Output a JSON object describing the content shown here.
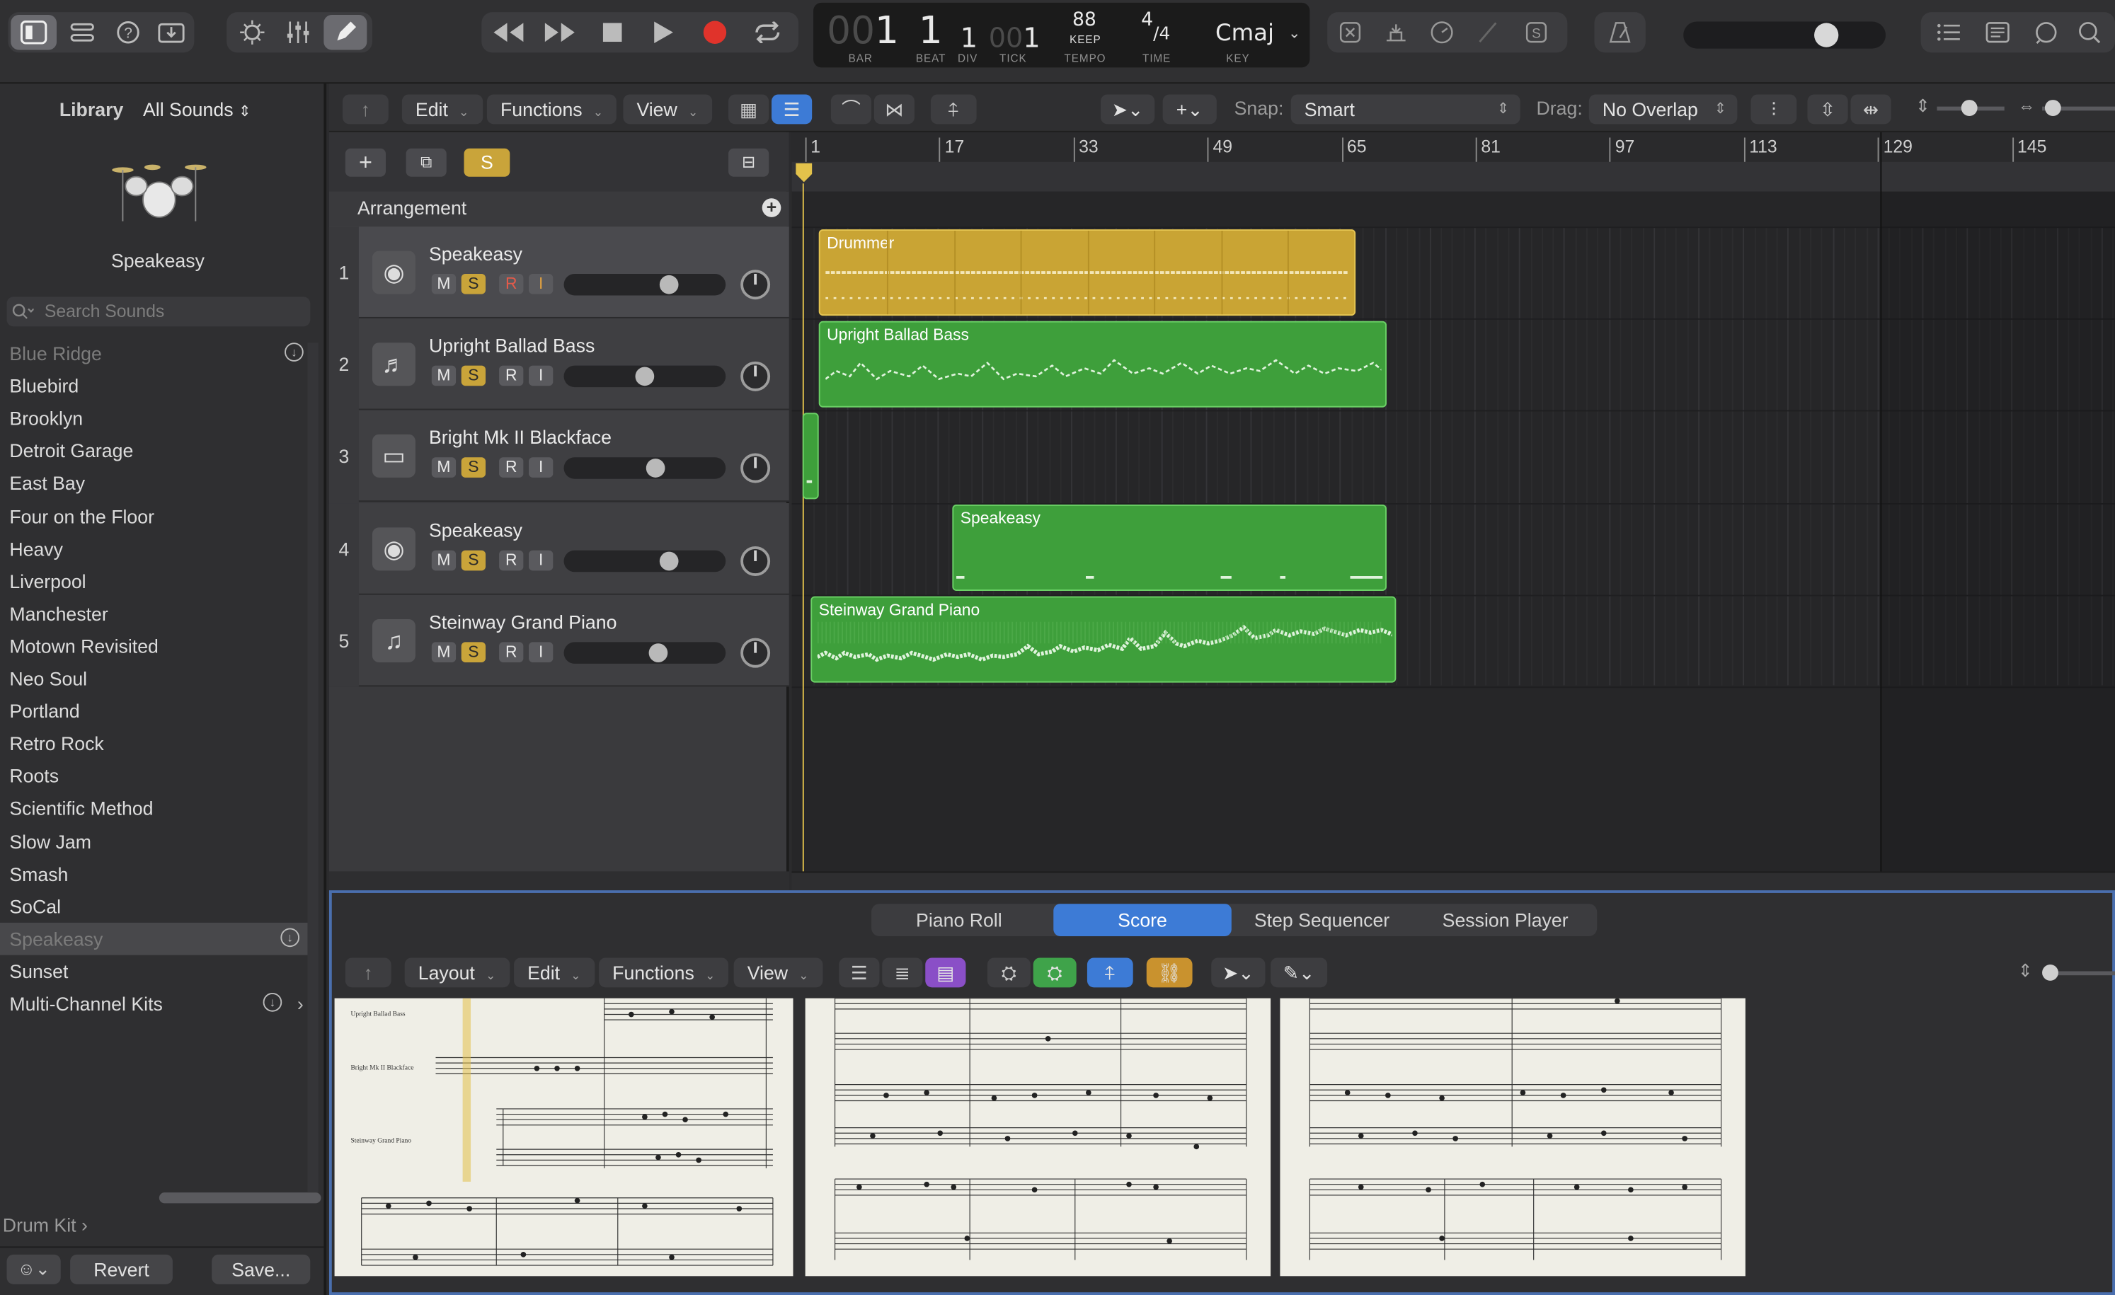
{
  "transport": {
    "bar_dim": "00",
    "bar": "1",
    "beat": "1",
    "div": "1",
    "tick_dim": "00",
    "tick": "1",
    "tempo": "88",
    "tempo_mode": "KEEP",
    "sig_num": "4",
    "sig_den": "/4",
    "key": "Cmaj",
    "labels": {
      "bar": "BAR",
      "beat": "BEAT",
      "div": "DIV",
      "tick": "TICK",
      "tempo": "TEMPO",
      "time": "TIME",
      "key": "KEY"
    }
  },
  "library": {
    "title": "Library",
    "filter": "All Sounds",
    "patch_name": "Speakeasy",
    "search_placeholder": "Search Sounds",
    "items": [
      "Blue Ridge",
      "Bluebird",
      "Brooklyn",
      "Detroit Garage",
      "East Bay",
      "Four on the Floor",
      "Heavy",
      "Liverpool",
      "Manchester",
      "Motown Revisited",
      "Neo Soul",
      "Portland",
      "Retro Rock",
      "Roots",
      "Scientific Method",
      "Slow Jam",
      "Smash",
      "SoCal",
      "Speakeasy",
      "Sunset",
      "Multi-Channel Kits"
    ],
    "footer_category": "Drum Kit",
    "revert": "Revert",
    "save": "Save..."
  },
  "tracks_header": {
    "edit": "Edit",
    "functions": "Functions",
    "view": "View",
    "snap_label": "Snap:",
    "snap_value": "Smart",
    "drag_label": "Drag:",
    "drag_value": "No Overlap"
  },
  "arrangement": {
    "label": "Arrangement",
    "solo": "S",
    "ruler": [
      "1",
      "17",
      "33",
      "49",
      "65",
      "81",
      "97",
      "113",
      "129",
      "145"
    ]
  },
  "tracks": [
    {
      "num": "1",
      "name": "Speakeasy",
      "volume": 0.67
    },
    {
      "num": "2",
      "name": "Upright Ballad Bass",
      "volume": 0.5
    },
    {
      "num": "3",
      "name": "Bright Mk II Blackface",
      "volume": 0.58
    },
    {
      "num": "4",
      "name": "Speakeasy",
      "volume": 0.67
    },
    {
      "num": "5",
      "name": "Steinway Grand Piano",
      "volume": 0.6
    }
  ],
  "track_buttons": {
    "mute": "M",
    "solo": "S",
    "record": "R",
    "input": "I"
  },
  "regions": {
    "drummer": "Drummer",
    "bass": "Upright Ballad Bass",
    "drums2": "Speakeasy",
    "piano": "Steinway Grand Piano"
  },
  "editor": {
    "tabs": [
      "Piano Roll",
      "Score",
      "Step Sequencer",
      "Session Player"
    ],
    "active_tab": "Score",
    "layout": "Layout",
    "edit": "Edit",
    "functions": "Functions",
    "view": "View",
    "staff_labels": [
      "Upright Ballad Bass",
      "Bright Mk II Blackface",
      "Steinway Grand Piano"
    ]
  },
  "colors": {
    "accent_blue": "#3d7bd6",
    "region_gold": "#c9a434",
    "region_green": "#3e9f3b",
    "solo_yellow": "#c9a43a",
    "record_red": "#e0332b"
  }
}
